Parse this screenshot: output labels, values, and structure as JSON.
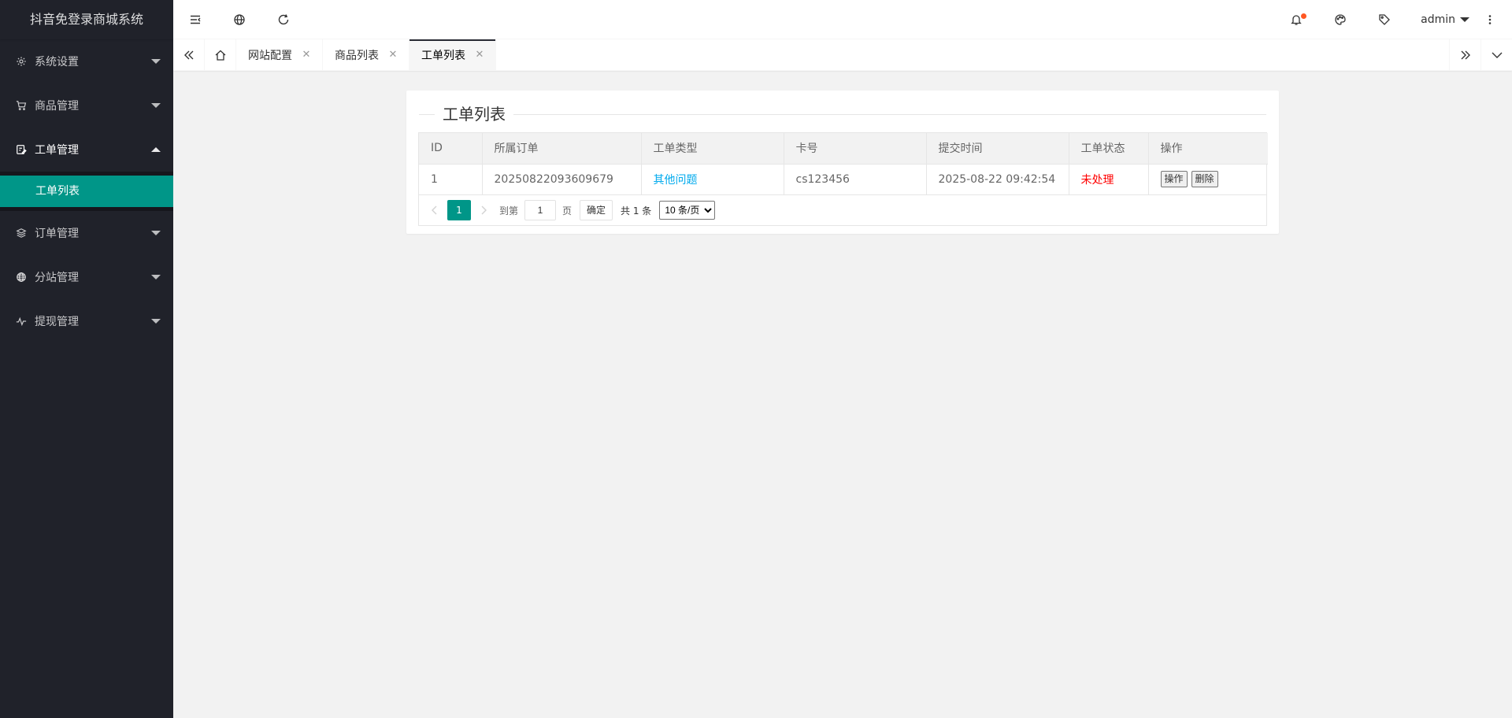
{
  "app": {
    "title": "抖音免登录商城系统"
  },
  "sidebar": {
    "items": [
      {
        "label": "系统设置",
        "icon": "gear-icon",
        "expanded": false
      },
      {
        "label": "商品管理",
        "icon": "cart-icon",
        "expanded": false
      },
      {
        "label": "工单管理",
        "icon": "edit-icon",
        "expanded": true,
        "children": [
          {
            "label": "工单列表",
            "active": true
          }
        ]
      },
      {
        "label": "订单管理",
        "icon": "layers-icon",
        "expanded": false
      },
      {
        "label": "分站管理",
        "icon": "globe-icon",
        "expanded": false
      },
      {
        "label": "提现管理",
        "icon": "pulse-icon",
        "expanded": false
      }
    ]
  },
  "header": {
    "user": "admin",
    "icons": [
      "shrink-menu-icon",
      "globe-icon",
      "refresh-icon",
      "bell-icon",
      "theme-icon",
      "tag-icon",
      "more-icon"
    ],
    "notification_dot_color": "#ff5722"
  },
  "tabs": {
    "items": [
      {
        "label": "网站配置",
        "active": false
      },
      {
        "label": "商品列表",
        "active": false
      },
      {
        "label": "工单列表",
        "active": true
      }
    ]
  },
  "panel": {
    "title": "工单列表",
    "columns": [
      "ID",
      "所属订单",
      "工单类型",
      "卡号",
      "提交时间",
      "工单状态",
      "操作"
    ],
    "rows": [
      {
        "id": "1",
        "order": "20250822093609679",
        "type": "其他问题",
        "card": "cs123456",
        "time": "2025-08-22 09:42:54",
        "status": "未处理",
        "actions": [
          "操作",
          "删除"
        ]
      }
    ],
    "pager": {
      "current": "1",
      "goto_label": "到第",
      "goto_value": "1",
      "page_unit": "页",
      "confirm": "确定",
      "total": "共 1 条",
      "page_size": "10 条/页"
    }
  },
  "colors": {
    "sidebar_bg": "#20222a",
    "accent": "#009688",
    "link": "#01AAED",
    "status_red": "#ff0000"
  }
}
